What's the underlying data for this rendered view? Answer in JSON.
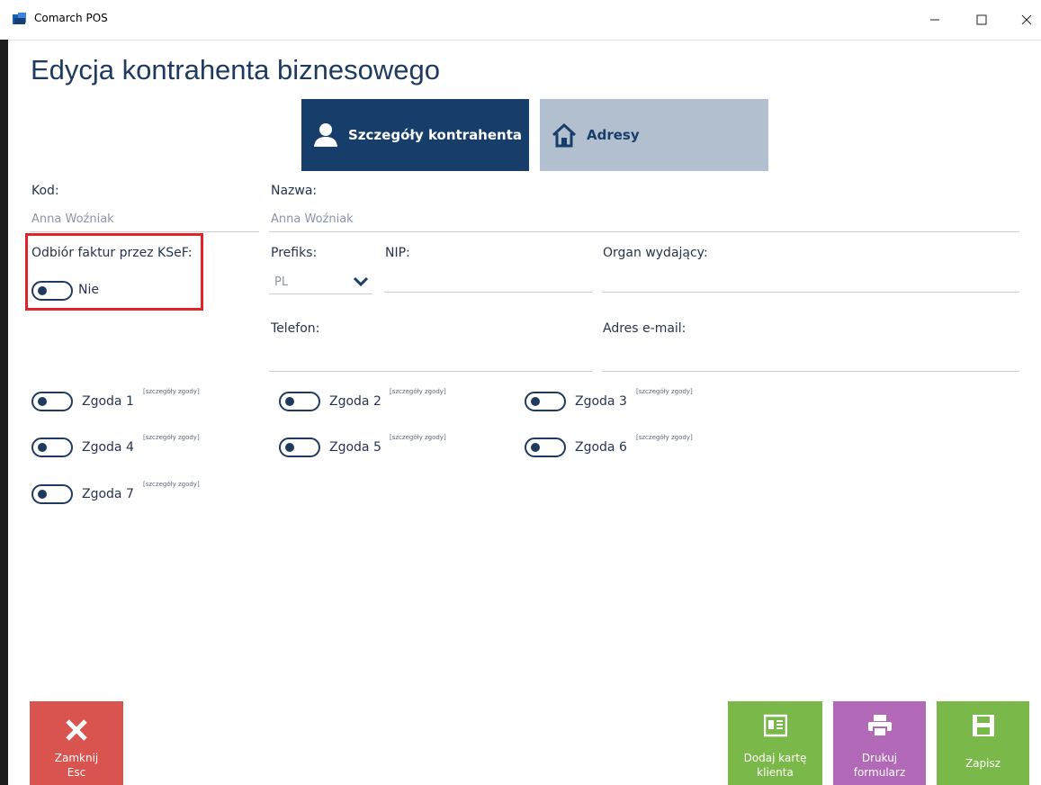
{
  "window": {
    "title": "Comarch POS"
  },
  "page": {
    "title": "Edycja kontrahenta biznesowego"
  },
  "tabs": [
    {
      "label": "Szczegóły kontrahenta",
      "active": true
    },
    {
      "label": "Adresy",
      "active": false
    }
  ],
  "fields": {
    "kod": {
      "label": "Kod:",
      "value": "Anna Woźniak"
    },
    "nazwa": {
      "label": "Nazwa:",
      "value": "Anna Woźniak"
    },
    "ksef": {
      "label": "Odbiór faktur przez KSeF:",
      "state_label": "Nie",
      "on": false
    },
    "prefiks": {
      "label": "Prefiks:",
      "value": "PL"
    },
    "nip": {
      "label": "NIP:",
      "value": ""
    },
    "organ": {
      "label": "Organ wydający:",
      "value": ""
    },
    "telefon": {
      "label": "Telefon:",
      "value": ""
    },
    "email": {
      "label": "Adres e-mail:",
      "value": ""
    }
  },
  "consents": [
    {
      "label": "Zgoda 1",
      "link": "[szczegóły zgody]",
      "on": false
    },
    {
      "label": "Zgoda 2",
      "link": "[szczegóły zgody]",
      "on": false
    },
    {
      "label": "Zgoda 3",
      "link": "[szczegóły zgody]",
      "on": false
    },
    {
      "label": "Zgoda 4",
      "link": "[szczegóły zgody]",
      "on": false
    },
    {
      "label": "Zgoda 5",
      "link": "[szczegóły zgody]",
      "on": false
    },
    {
      "label": "Zgoda 6",
      "link": "[szczegóły zgody]",
      "on": false
    },
    {
      "label": "Zgoda 7",
      "link": "[szczegóły zgody]",
      "on": false
    }
  ],
  "buttons": {
    "close": {
      "line1": "Zamknij",
      "line2": "Esc"
    },
    "add_card": {
      "line1": "Dodaj kartę",
      "line2": "klienta"
    },
    "print": {
      "line1": "Drukuj",
      "line2": "formularz"
    },
    "save": {
      "line1": "Zapisz"
    }
  },
  "colors": {
    "primary": "#173e6b",
    "tab_inactive": "#b2bfcf",
    "close": "#d9534f",
    "green": "#7bb84a",
    "purple": "#b169b8",
    "highlight": "#e2232a"
  },
  "icons": {
    "tab_details": "person-icon",
    "tab_address": "house-icon",
    "close": "close-x-icon",
    "add_card": "id-card-icon",
    "print": "printer-icon",
    "save": "floppy-disk-icon"
  }
}
